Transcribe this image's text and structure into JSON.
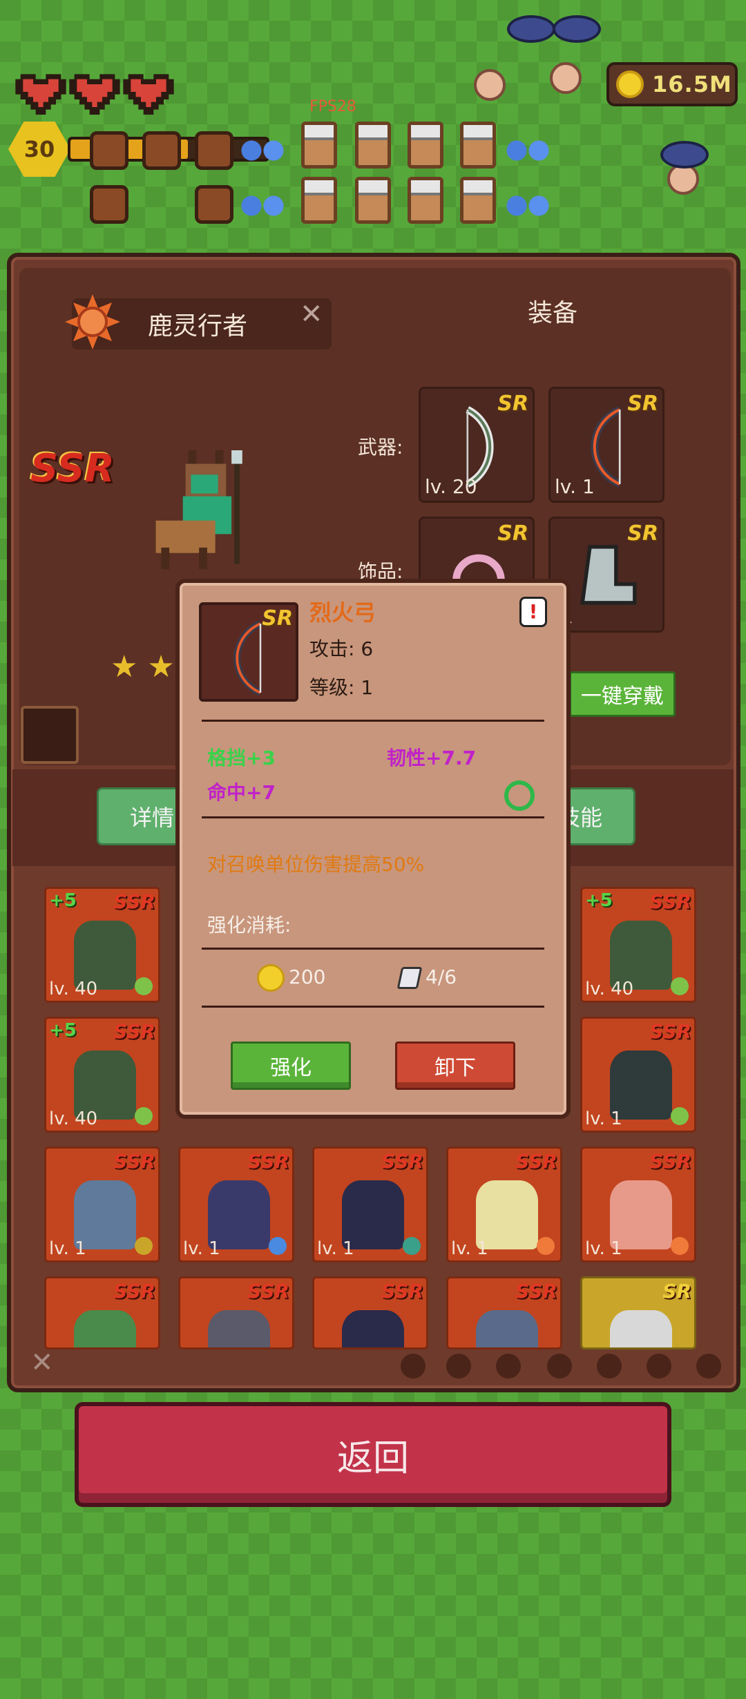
{
  "hud": {
    "level": "30",
    "xp_fraction": 0.6,
    "coins": "16.5M",
    "fps": "FPS28"
  },
  "hero": {
    "name": "鹿灵行者",
    "rarity": "SSR",
    "stars": "★ ★"
  },
  "equipment": {
    "title": "装备",
    "weapon_label": "武器:",
    "accessory_label": "饰品:",
    "equip_all": "一键穿戴",
    "slots": [
      {
        "rarity": "SR",
        "level": "lv. 20",
        "icon": "bow-icon"
      },
      {
        "rarity": "SR",
        "level": "lv. 1",
        "icon": "fire-bow-icon"
      },
      {
        "rarity": "SR",
        "level": "",
        "icon": "ring-icon"
      },
      {
        "rarity": "SR",
        "level": ".1",
        "icon": "boots-icon"
      }
    ]
  },
  "tabs": {
    "detail": "详情",
    "skill": "技能"
  },
  "cards": [
    {
      "plus": "+5",
      "rarity": "SSR",
      "level": "lv. 40",
      "color": "#3e5a3a",
      "elem": "#7fc24a"
    },
    {
      "plus": "+5",
      "rarity": "SSR",
      "level": "lv. 40",
      "color": "#3e5a3a",
      "elem": "#7fc24a"
    },
    {
      "plus": "+5",
      "rarity": "SSR",
      "level": "lv. 40",
      "color": "#3e5a3a",
      "elem": "#7fc24a"
    },
    {
      "plus": "",
      "rarity": "SSR",
      "level": "lv. 1",
      "color": "#2f3a3a",
      "elem": "#7fc24a"
    },
    {
      "plus": "",
      "rarity": "SSR",
      "level": "lv. 1",
      "color": "#5f7a9a",
      "elem": "#c9a62a"
    },
    {
      "plus": "",
      "rarity": "SSR",
      "level": "lv. 1",
      "color": "#3a3a6a",
      "elem": "#4a8ae0"
    },
    {
      "plus": "",
      "rarity": "SSR",
      "level": "lv. 1",
      "color": "#2a2a4a",
      "elem": "#3aa08a"
    },
    {
      "plus": "",
      "rarity": "SSR",
      "level": "lv. 1",
      "color": "#e8e0a0",
      "elem": "#f07a3a"
    },
    {
      "plus": "",
      "rarity": "SSR",
      "level": "lv. 1",
      "color": "#e89a8a",
      "elem": "#f07a3a"
    },
    {
      "plus": "",
      "rarity": "SSR",
      "level": "",
      "color": "#4a8a4a",
      "elem": ""
    },
    {
      "plus": "",
      "rarity": "SSR",
      "level": "",
      "color": "#5a5a6a",
      "elem": ""
    },
    {
      "plus": "",
      "rarity": "SSR",
      "level": "",
      "color": "#2a2a4a",
      "elem": ""
    },
    {
      "plus": "",
      "rarity": "SSR",
      "level": "",
      "color": "#5a6a8a",
      "elem": ""
    },
    {
      "plus": "",
      "rarity": "SR",
      "level": "",
      "color": "#d8d8d8",
      "elem": ""
    }
  ],
  "popup": {
    "item_name": "烈火弓",
    "rarity": "SR",
    "attack": "攻击: 6",
    "level": "等级: 1",
    "attr_block": "格挡+3",
    "attr_tough": "韧性+7.7",
    "attr_hit": "命中+7",
    "effect": "对召唤单位伤害提高50%",
    "cost_label": "强化消耗:",
    "cost_gold": "200",
    "cost_stone": "4/6",
    "enhance": "强化",
    "unequip": "卸下"
  },
  "back_button": "返回"
}
